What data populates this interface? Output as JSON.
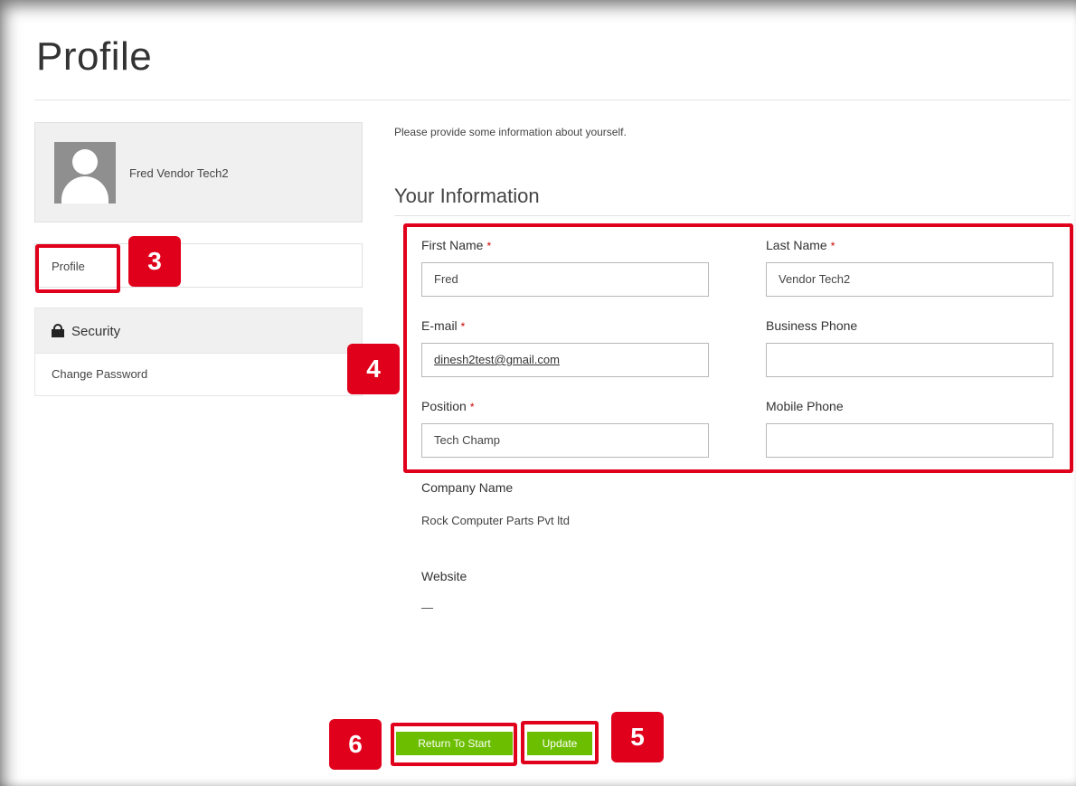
{
  "page": {
    "title": "Profile"
  },
  "user": {
    "display_name": "Fred Vendor Tech2"
  },
  "sidebar": {
    "profile_label": "Profile",
    "security_label": "Security",
    "change_password_label": "Change Password"
  },
  "form": {
    "intro": "Please provide some information about yourself.",
    "section_title": "Your Information",
    "required_marker": "*",
    "fields": {
      "first_name": {
        "label": "First Name",
        "value": "Fred",
        "required": true
      },
      "last_name": {
        "label": "Last Name",
        "value": "Vendor Tech2",
        "required": true
      },
      "email": {
        "label": "E-mail",
        "value": "dinesh2test@gmail.com",
        "required": true
      },
      "business_phone": {
        "label": "Business Phone",
        "value": "",
        "required": false
      },
      "position": {
        "label": "Position",
        "value": "Tech Champ",
        "required": true
      },
      "mobile_phone": {
        "label": "Mobile Phone",
        "value": "",
        "required": false
      }
    },
    "company": {
      "label": "Company Name",
      "value": "Rock Computer Parts Pvt ltd"
    },
    "website": {
      "label": "Website",
      "value": "—"
    }
  },
  "buttons": {
    "return_label": "Return To Start",
    "update_label": "Update"
  },
  "annotations": {
    "badge_3": "3",
    "badge_4": "4",
    "badge_5": "5",
    "badge_6": "6"
  },
  "colors": {
    "accent_button": "#6cbf00",
    "annotation_red": "#e0001b",
    "required": "#cc0000"
  }
}
